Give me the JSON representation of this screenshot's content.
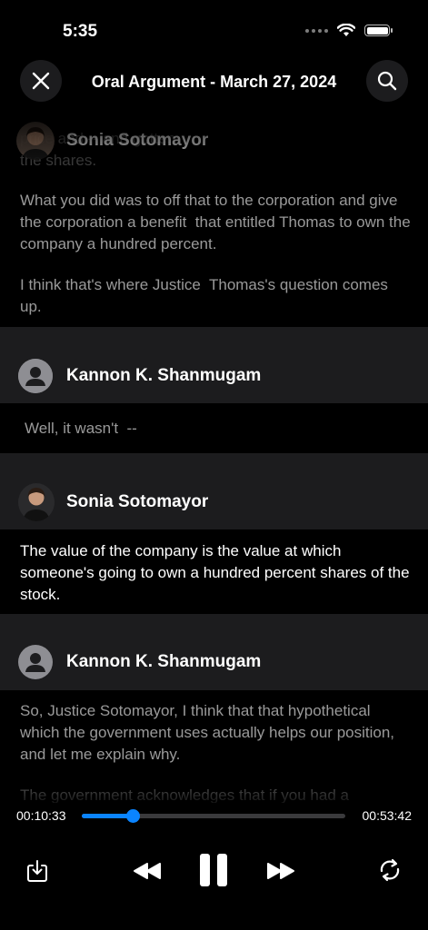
{
  "status_bar": {
    "time": "5:35"
  },
  "header": {
    "title": "Oral Argument - March 27, 2024"
  },
  "transcript": {
    "blocks": [
      {
        "speaker": "Sonia Sotomayor",
        "avatar": "photo",
        "faded_text": "price and -- and gotten\nthe shares.",
        "paragraphs": [
          "What you did was to off that to the corporation and give the corporation a benefit  that entitled Thomas to own the company a hundred percent.",
          "I think that's where Justice  Thomas's question comes up."
        ]
      },
      {
        "speaker": "Kannon K. Shanmugam",
        "avatar": "generic",
        "text": "Well, it wasn't  --"
      },
      {
        "speaker": "Sonia Sotomayor",
        "avatar": "photo",
        "text": "The value of the company is the value at which someone's going to own a hundred percent shares of the stock."
      },
      {
        "speaker": "Kannon K. Shanmugam",
        "avatar": "generic",
        "text": "So, Justice Sotomayor, I think that that hypothetical which the government uses actually helps our position, and let me explain why.",
        "partial_text": "The government acknowledges that if you had a"
      }
    ]
  },
  "player": {
    "current_time": "00:10:33",
    "total_time": "00:53:42",
    "progress": 0.196,
    "accent_color": "#0a84ff"
  },
  "icons": [
    "close-icon",
    "search-icon",
    "download-icon",
    "rewind-icon",
    "pause-icon",
    "fast-forward-icon",
    "repeat-icon"
  ]
}
